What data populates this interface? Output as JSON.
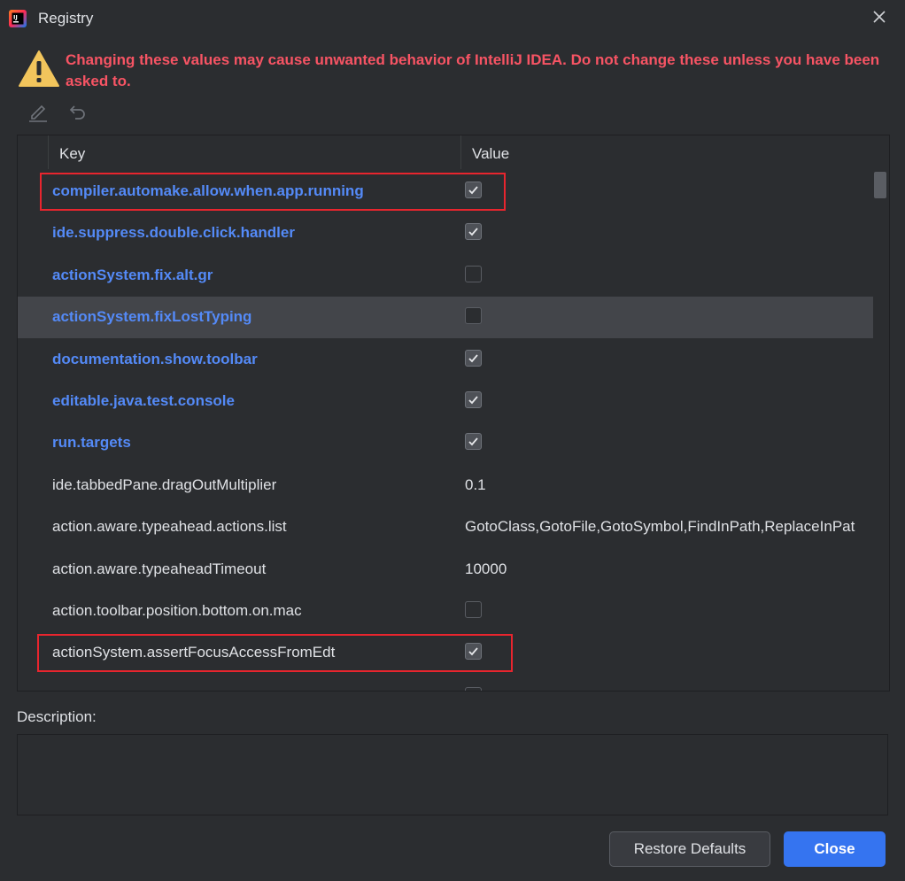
{
  "window": {
    "title": "Registry",
    "icons": {
      "app": "intellij-app-icon",
      "close": "close-icon"
    }
  },
  "warning": {
    "icon": "warning-triangle-icon",
    "text": "Changing these values may cause unwanted behavior of IntelliJ IDEA. Do not change these unless you have been asked to."
  },
  "toolbar": {
    "edit_icon": "edit-pencil-icon",
    "revert_icon": "revert-icon"
  },
  "table": {
    "headers": {
      "key": "Key",
      "value": "Value"
    },
    "rows": [
      {
        "key": "compiler.automake.allow.when.app.running",
        "type": "checkbox",
        "checked": true,
        "modified": true,
        "highlighted": true
      },
      {
        "key": "ide.suppress.double.click.handler",
        "type": "checkbox",
        "checked": true,
        "modified": true
      },
      {
        "key": "actionSystem.fix.alt.gr",
        "type": "checkbox",
        "checked": false,
        "modified": true
      },
      {
        "key": "actionSystem.fixLostTyping",
        "type": "checkbox",
        "checked": false,
        "modified": true,
        "selected": true
      },
      {
        "key": "documentation.show.toolbar",
        "type": "checkbox",
        "checked": true,
        "modified": true
      },
      {
        "key": "editable.java.test.console",
        "type": "checkbox",
        "checked": true,
        "modified": true
      },
      {
        "key": "run.targets",
        "type": "checkbox",
        "checked": true,
        "modified": true
      },
      {
        "key": "ide.tabbedPane.dragOutMultiplier",
        "type": "text",
        "value": "0.1"
      },
      {
        "key": "action.aware.typeahead.actions.list",
        "type": "text",
        "value": "GotoClass,GotoFile,GotoSymbol,FindInPath,ReplaceInPat"
      },
      {
        "key": "action.aware.typeaheadTimeout",
        "type": "text",
        "value": "10000"
      },
      {
        "key": "action.toolbar.position.bottom.on.mac",
        "type": "checkbox",
        "checked": false
      },
      {
        "key": "actionSystem.assertFocusAccessFromEdt",
        "type": "checkbox",
        "checked": true,
        "highlighted": true
      }
    ]
  },
  "description": {
    "label": "Description:",
    "text": ""
  },
  "buttons": {
    "restore": "Restore Defaults",
    "close": "Close"
  },
  "colors": {
    "background": "#2b2d30",
    "warning_text": "#f75464",
    "modified_key": "#548af7",
    "selected_row": "#43454a",
    "highlight_box": "#e8252e",
    "primary_button": "#3574f0"
  }
}
